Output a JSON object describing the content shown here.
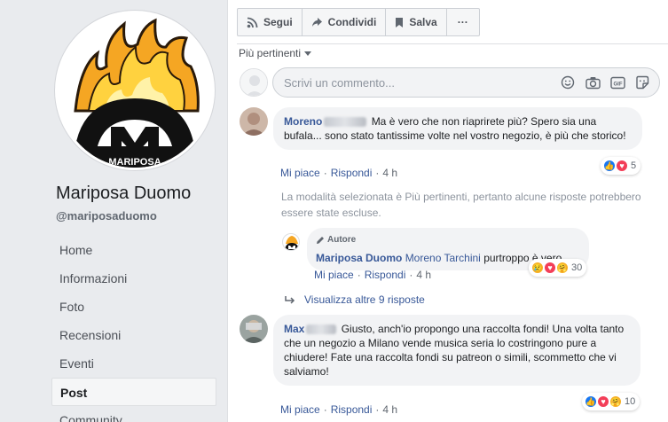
{
  "page": {
    "name": "Mariposa Duomo",
    "handle": "@mariposaduomo",
    "logo_text": "MARIPOSA"
  },
  "nav": {
    "items": [
      {
        "label": "Home"
      },
      {
        "label": "Informazioni"
      },
      {
        "label": "Foto"
      },
      {
        "label": "Recensioni"
      },
      {
        "label": "Eventi"
      },
      {
        "label": "Post"
      },
      {
        "label": "Community"
      }
    ]
  },
  "actions": {
    "follow": "Segui",
    "share": "Condividi",
    "save": "Salva",
    "more": "···"
  },
  "sort": {
    "label": "Più pertinenti"
  },
  "composer": {
    "placeholder": "Scrivi un commento..."
  },
  "comments": [
    {
      "author": "Moreno",
      "text": "Ma è vero che non riaprirete più? Spero sia una bufala... sono stato tantissime volte nel vostro negozio, è più che storico!",
      "like": "Mi piace",
      "reply": "Rispondi",
      "time": "4 h",
      "reactions": "5"
    },
    {
      "author": "Max",
      "text": "Giusto, anch'io propongo una raccolta fondi! Una volta tanto che un negozio a Milano vende musica seria lo costringono pure a chiudere! Fate una raccolta fondi su patreon o simili, scommetto che vi salviamo!",
      "like": "Mi piace",
      "reply": "Rispondi",
      "time": "4 h",
      "reactions": "10"
    }
  ],
  "notice": "La modalità selezionata è Più pertinenti, pertanto alcune risposte potrebbero essere state escluse.",
  "reply": {
    "badge": "Autore",
    "author": "Mariposa Duomo",
    "mention": "Moreno Tarchini",
    "text": "purtroppo è vero",
    "like": "Mi piace",
    "reply": "Rispondi",
    "time": "4 h",
    "reactions": "30"
  },
  "more_replies": "Visualizza altre 9 risposte",
  "colors": {
    "link": "#385898",
    "like_blue": "#1877f2",
    "love_red": "#f33e58",
    "haha_yellow": "#f7b125"
  }
}
